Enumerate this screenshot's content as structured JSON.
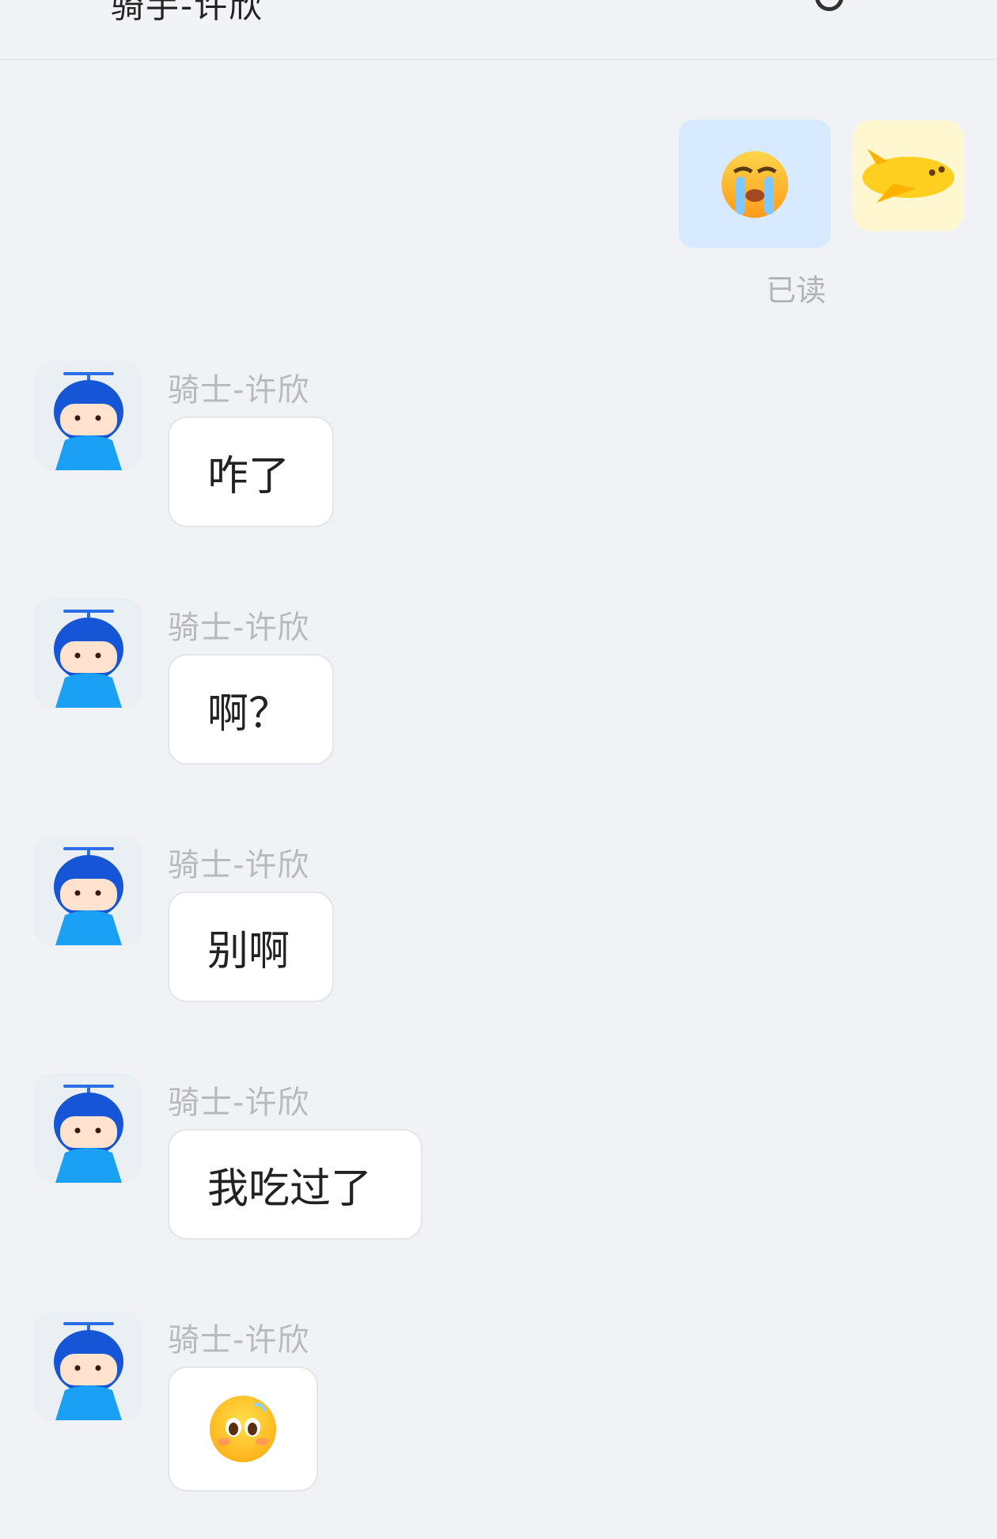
{
  "header": {
    "title": "骑手-许欣"
  },
  "sent": {
    "status": "已读"
  },
  "messages": [
    {
      "sender": "骑士-许欣",
      "text": "咋了"
    },
    {
      "sender": "骑士-许欣",
      "text": "啊？"
    },
    {
      "sender": "骑士-许欣",
      "text": "别啊"
    },
    {
      "sender": "骑士-许欣",
      "text": "我吃过了"
    },
    {
      "sender": "骑士-许欣",
      "text": ""
    }
  ],
  "colors": {
    "background": "#f0f2f5",
    "sent_bubble": "#d7eaff",
    "received_bubble": "#ffffff",
    "secondary_text": "#b7b9bd"
  }
}
